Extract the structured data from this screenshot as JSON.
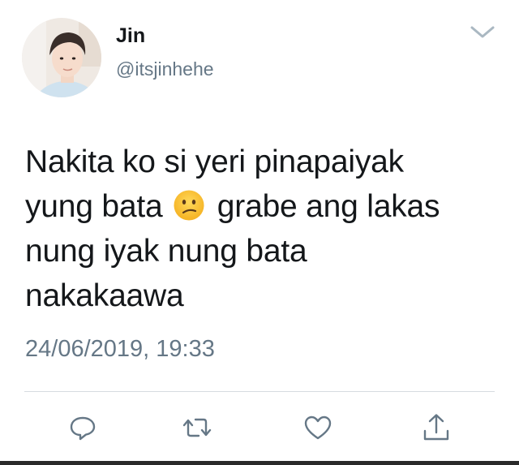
{
  "user": {
    "display_name": "Jin",
    "handle": "@itsjinhehe"
  },
  "tweet": {
    "lines": [
      "Nakita ko si yeri pinapaiyak",
      "yung bata",
      "grabe ang lakas",
      "nung iyak nung bata",
      "nakakaawa"
    ],
    "emoji": "confused-face-emoji",
    "timestamp": "24/06/2019, 19:33"
  },
  "actions": {
    "icons": [
      "reply-icon",
      "retweet-icon",
      "like-icon",
      "share-icon"
    ]
  },
  "colors": {
    "text": "#14171a",
    "secondary": "#657786",
    "divider": "#d6dbe0",
    "icon": "#657786",
    "chevron": "#aab8c2"
  }
}
